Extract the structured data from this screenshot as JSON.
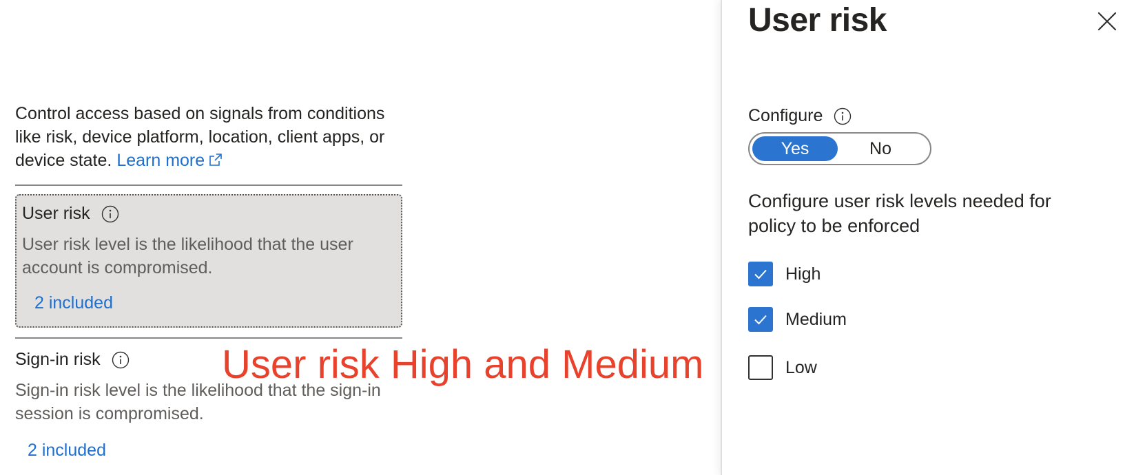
{
  "left": {
    "intro_text": "Control access based on signals from conditions like risk, device platform, location, client apps, or device state.",
    "learn_more": "Learn more",
    "user_risk": {
      "title": "User risk",
      "description": "User risk level is the likelihood that the user account is compromised.",
      "link": "2 included"
    },
    "signin_risk": {
      "title": "Sign-in risk",
      "description": "Sign-in risk level is the likelihood that the sign-in session is compromised.",
      "link": "2 included"
    },
    "annotation": "User risk High and Medium"
  },
  "panel": {
    "title": "User risk",
    "configure_label": "Configure",
    "toggle": {
      "yes": "Yes",
      "no": "No",
      "selected": "Yes"
    },
    "levels_description": "Configure user risk levels needed for policy to be enforced",
    "levels": [
      {
        "label": "High",
        "checked": true
      },
      {
        "label": "Medium",
        "checked": true
      },
      {
        "label": "Low",
        "checked": false
      }
    ]
  },
  "colors": {
    "accent": "#2b74cf",
    "link": "#1f6fce",
    "annotation": "#e8412c",
    "card_bg": "#e1e0df"
  }
}
